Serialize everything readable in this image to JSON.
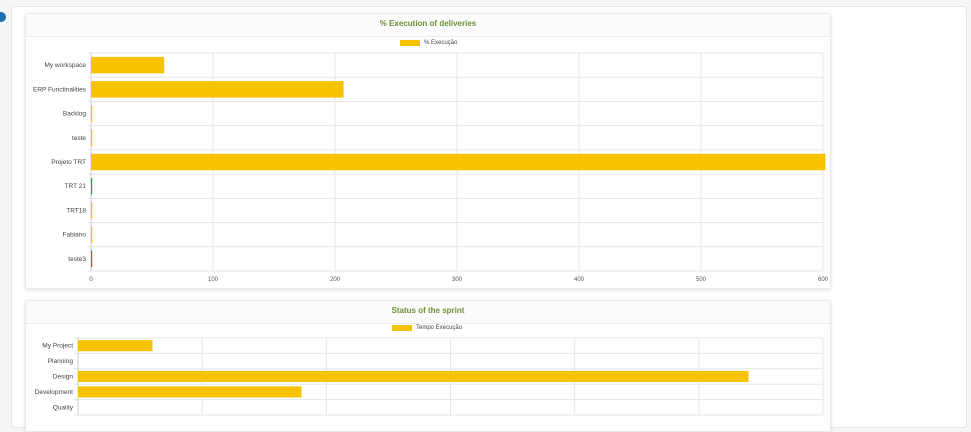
{
  "theme": {
    "title_color": "#6d8f34",
    "bar_color": "#f7c200"
  },
  "chart_data": [
    {
      "type": "bar",
      "orientation": "horizontal",
      "title": "% Execution of deliveries",
      "legend": "% Execução",
      "categories": [
        "My workspace",
        "ERP Functinalities",
        "Backlog",
        "teste",
        "Projeto TRT",
        "TRT 21",
        "TRT18",
        "Fabiano",
        "teste3"
      ],
      "values": [
        60,
        207,
        1,
        1,
        602,
        1,
        1,
        1,
        1
      ],
      "bar_colors": [
        "#f7c200",
        "#f7c200",
        "#f7c200",
        "#f7c200",
        "#f7c200",
        "#2e9e4f",
        "#f7c200",
        "#f7c200",
        "#e53935"
      ],
      "xlim": [
        0,
        600
      ],
      "xticks": [
        "0",
        "100",
        "200",
        "300",
        "400",
        "500",
        "600"
      ],
      "grid": true,
      "legend_position": "top-center"
    },
    {
      "type": "bar",
      "orientation": "horizontal",
      "title": "Status of the sprint",
      "legend": "Tempo Execução",
      "categories": [
        "My Project",
        "Planning",
        "Design",
        "Development",
        "Quality"
      ],
      "values": [
        60,
        0,
        540,
        180,
        0
      ],
      "bar_colors": [
        "#f7c200",
        "#f7c200",
        "#f7c200",
        "#f7c200",
        "#f7c200"
      ],
      "grid": true,
      "legend_position": "top-center"
    }
  ]
}
